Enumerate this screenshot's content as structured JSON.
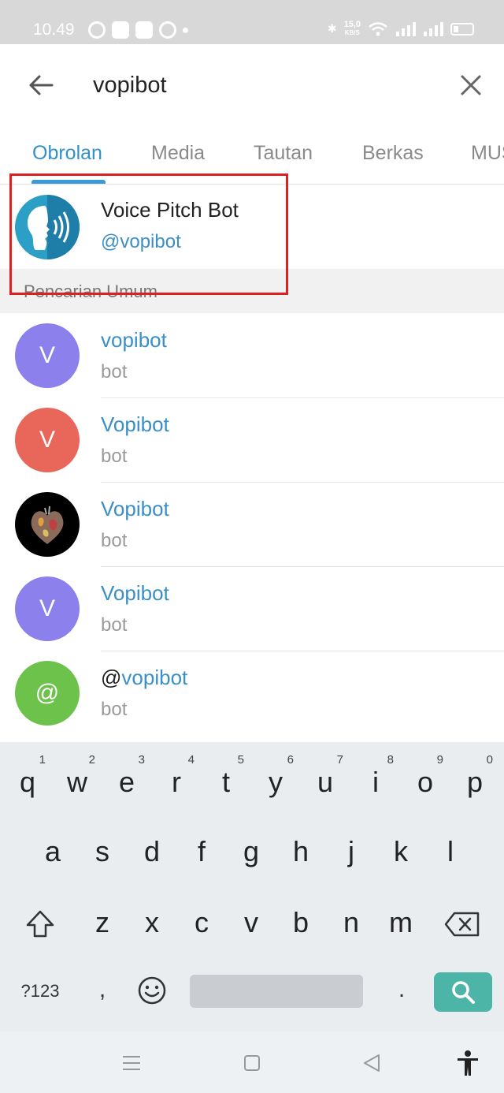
{
  "status_bar": {
    "time": "10.49",
    "speed_value": "15,0",
    "speed_unit": "KB/S"
  },
  "header": {
    "search_query": "vopibot"
  },
  "tabs": [
    {
      "label": "Obrolan",
      "active": true
    },
    {
      "label": "Media",
      "active": false
    },
    {
      "label": "Tautan",
      "active": false
    },
    {
      "label": "Berkas",
      "active": false
    },
    {
      "label": "MUSIK",
      "active": false
    }
  ],
  "top_result": {
    "name": "Voice Pitch Bot",
    "handle": "@vopibot"
  },
  "section": {
    "title": "Pencarian Umum"
  },
  "global_results": [
    {
      "initial": "V",
      "name": "vopibot",
      "sub": "bot",
      "avatar_color": "#8b80ec"
    },
    {
      "initial": "V",
      "name": "Vopibot",
      "sub": "bot",
      "avatar_color": "#e8665a"
    },
    {
      "initial": "",
      "name": "Vopibot",
      "sub": "bot",
      "avatar_color": "#000000"
    },
    {
      "initial": "V",
      "name": "Vopibot",
      "sub": "bot",
      "avatar_color": "#8b80ec"
    },
    {
      "initial": "@",
      "name_prefix": "@",
      "name": "vopibot",
      "sub": "bot",
      "avatar_color": "#6cc24a"
    }
  ],
  "keyboard": {
    "row1": [
      {
        "k": "q",
        "n": "1"
      },
      {
        "k": "w",
        "n": "2"
      },
      {
        "k": "e",
        "n": "3"
      },
      {
        "k": "r",
        "n": "4"
      },
      {
        "k": "t",
        "n": "5"
      },
      {
        "k": "y",
        "n": "6"
      },
      {
        "k": "u",
        "n": "7"
      },
      {
        "k": "i",
        "n": "8"
      },
      {
        "k": "o",
        "n": "9"
      },
      {
        "k": "p",
        "n": "0"
      }
    ],
    "row2": [
      "a",
      "s",
      "d",
      "f",
      "g",
      "h",
      "j",
      "k",
      "l"
    ],
    "row3": [
      "z",
      "x",
      "c",
      "v",
      "b",
      "n",
      "m"
    ],
    "symbols_label": "?123",
    "comma": ",",
    "period": "."
  },
  "colors": {
    "accent": "#3390c8",
    "highlight_box": "#e02020",
    "search_key": "#4db5a8"
  }
}
